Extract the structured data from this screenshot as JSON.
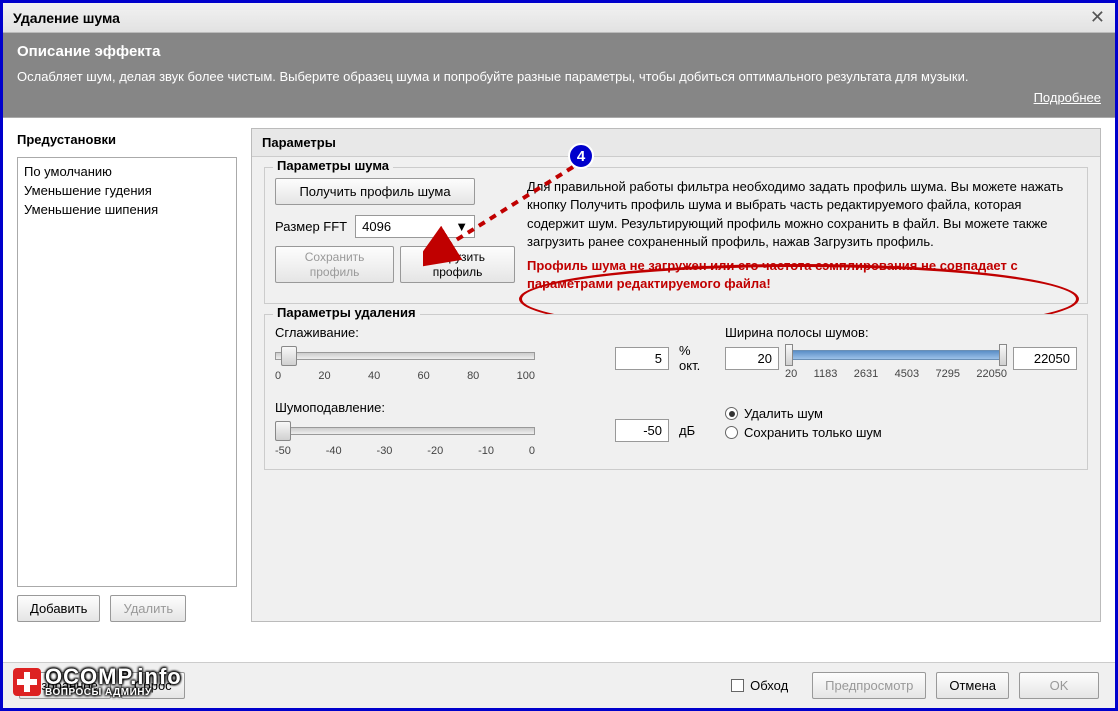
{
  "window": {
    "title": "Удаление шума"
  },
  "desc": {
    "title": "Описание эффекта",
    "text": "Ослабляет шум, делая звук более чистым. Выберите образец шума и попробуйте разные параметры, чтобы добиться оптимального результата для музыки.",
    "more": "Подробнее"
  },
  "presets": {
    "title": "Предустановки",
    "items": [
      "По умолчанию",
      "Уменьшение гудения",
      "Уменьшение шипения"
    ],
    "add": "Добавить",
    "remove": "Удалить"
  },
  "params": {
    "title": "Параметры",
    "noise": {
      "title": "Параметры шума",
      "get_profile": "Получить профиль шума",
      "fft_label": "Размер FFT",
      "fft_value": "4096",
      "save_profile": "Сохранить профиль",
      "load_profile": "Загрузить профиль",
      "info": "Для правильной работы фильтра необходимо задать профиль шума. Вы можете нажать кнопку Получить профиль шума и выбрать часть редактируемого файла, которая содержит шум. Результирующий профиль можно сохранить в файл. Вы можете также загрузить ранее сохраненный профиль, нажав Загрузить профиль.",
      "warning": "Профиль шума не загружен или его частота сэмплирования не совпадает с параметрами редактируемого файла!"
    },
    "removal": {
      "title": "Параметры удаления",
      "smoothing_label": "Сглаживание:",
      "smoothing_value": "5",
      "smoothing_unit": "% окт.",
      "smoothing_ticks": [
        "0",
        "20",
        "40",
        "60",
        "80",
        "100"
      ],
      "reduction_label": "Шумоподавление:",
      "reduction_value": "-50",
      "reduction_unit": "дБ",
      "reduction_ticks": [
        "-50",
        "-40",
        "-30",
        "-20",
        "-10",
        "0"
      ],
      "bandwidth_label": "Ширина полосы шумов:",
      "bandwidth_low": "20",
      "bandwidth_high": "22050",
      "bandwidth_ticks": [
        "20",
        "1183",
        "2631",
        "4503",
        "7295",
        "22050"
      ],
      "mode_remove": "Удалить шум",
      "mode_keep": "Сохранить только шум"
    }
  },
  "footer": {
    "fav": "Избранное",
    "reset": "Сброс",
    "bypass": "Обход",
    "preview": "Предпросмотр",
    "cancel": "Отмена",
    "ok": "OK"
  },
  "annotation": {
    "num": "4"
  },
  "watermark": {
    "main": "OCOMP.info",
    "sub": "ВОПРОСЫ АДМИНУ"
  }
}
